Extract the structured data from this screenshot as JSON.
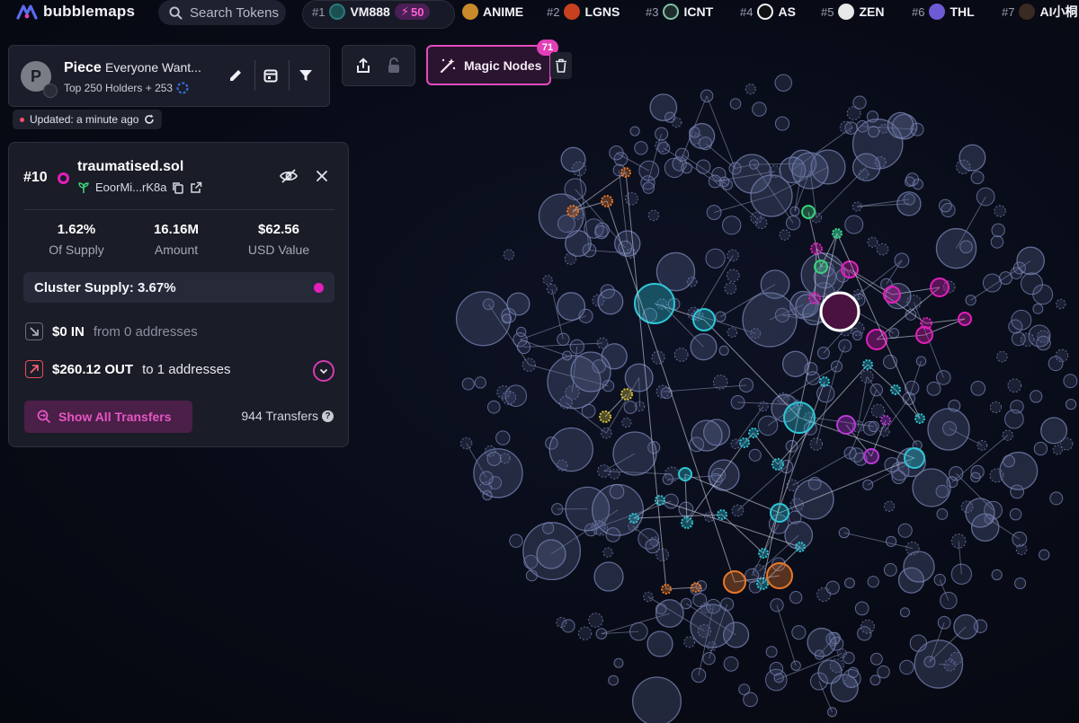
{
  "app": {
    "name": "bubblemaps"
  },
  "search": {
    "placeholder": "Search Tokens"
  },
  "trending": [
    {
      "rank": "#1",
      "symbol": "VM888",
      "boost": "50",
      "color": "#1c6e6e"
    },
    {
      "rank": "",
      "symbol": "ANIME",
      "color": "#c98a2c"
    },
    {
      "rank": "#2",
      "symbol": "LGNS",
      "color": "#c7401f"
    },
    {
      "rank": "#3",
      "symbol": "ICNT",
      "color": "#1f2d2a"
    },
    {
      "rank": "#4",
      "symbol": "AS",
      "color": "#f2f2f2"
    },
    {
      "rank": "#5",
      "symbol": "ZEN",
      "color": "#e8e8e8"
    },
    {
      "rank": "#6",
      "symbol": "THL",
      "color": "#6d5bd6"
    },
    {
      "rank": "#7",
      "symbol": "AI小桐",
      "color": "#3b2a22"
    }
  ],
  "token": {
    "avatar_letter": "P",
    "name": "Piece",
    "subtitle": "Everyone Want...",
    "holders": "Top 250 Holders + 253",
    "updated": "Updated: a minute ago",
    "icons": [
      "edit-icon",
      "calendar-icon",
      "filter-icon"
    ]
  },
  "toolbar": {
    "magic_label": "Magic Nodes",
    "magic_count": "71"
  },
  "wallet": {
    "rank": "#10",
    "name": "traumatised.sol",
    "address": "EoorMi...rK8a",
    "stats": [
      {
        "value": "1.62%",
        "label": "Of Supply"
      },
      {
        "value": "16.16M",
        "label": "Amount"
      },
      {
        "value": "$62.56",
        "label": "USD Value"
      }
    ],
    "cluster_supply": "Cluster Supply: 3.67%",
    "in_amount": "$0 IN",
    "in_detail": "from 0 addresses",
    "out_amount": "$260.12 OUT",
    "out_detail": "to 1 addresses",
    "show_transfers": "Show All Transfers",
    "transfer_count": "944 Transfers"
  },
  "colors": {
    "accent": "#e21fbb",
    "bubble_default": "#7a86b6",
    "cyan": "#2ec6d6",
    "orange": "#e8782a",
    "green": "#3ad07a",
    "yellow": "#d8c23a",
    "purple": "#b83ad8"
  }
}
